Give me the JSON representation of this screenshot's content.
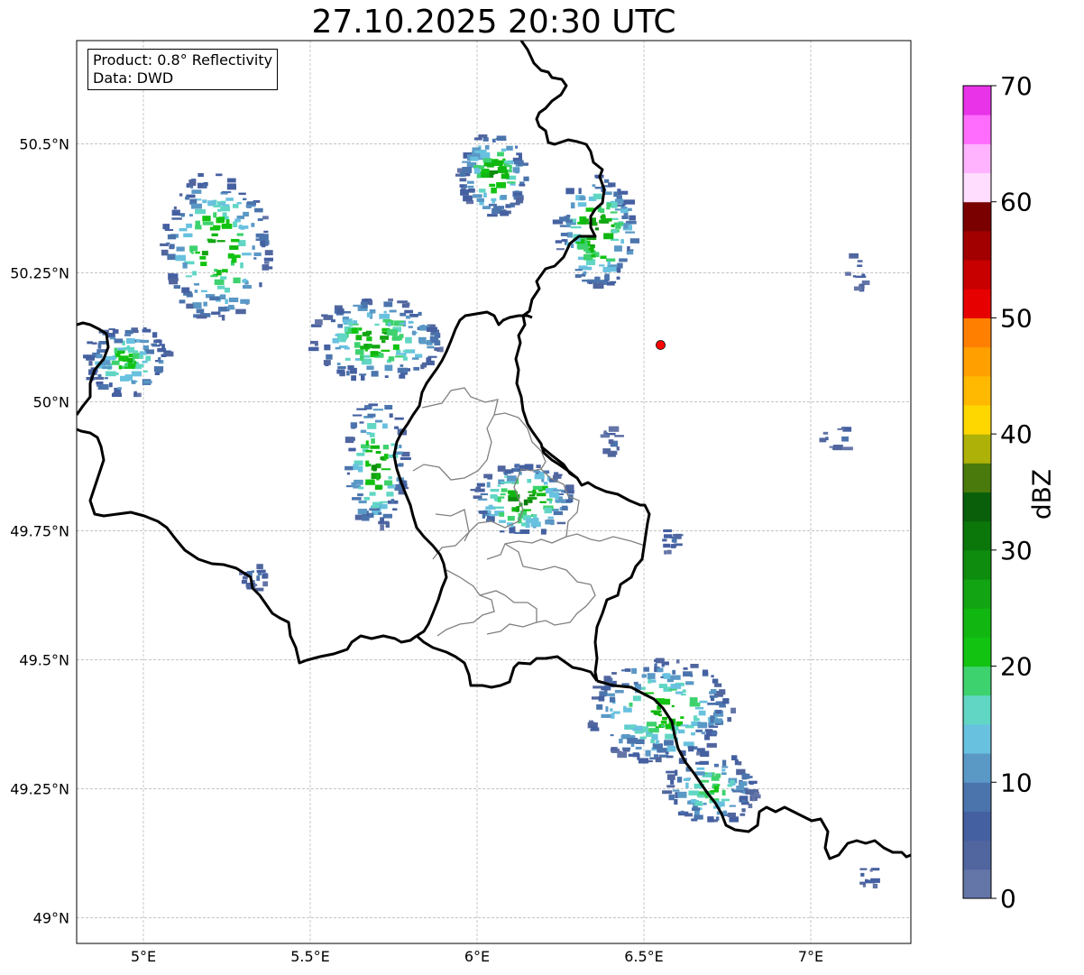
{
  "title": "27.10.2025 20:30 UTC",
  "info": {
    "product": "Product: 0.8° Reflectivity",
    "data": "Data: DWD"
  },
  "map": {
    "lon_range": [
      4.8,
      7.3
    ],
    "lat_range": [
      48.95,
      50.7
    ],
    "lon_ticks": [
      {
        "value": 5.0,
        "label": "5°E"
      },
      {
        "value": 5.5,
        "label": "5.5°E"
      },
      {
        "value": 6.0,
        "label": "6°E"
      },
      {
        "value": 6.5,
        "label": "6.5°E"
      },
      {
        "value": 7.0,
        "label": "7°E"
      }
    ],
    "lat_ticks": [
      {
        "value": 49.0,
        "label": "49°N"
      },
      {
        "value": 49.25,
        "label": "49.25°N"
      },
      {
        "value": 49.5,
        "label": "49.5°N"
      },
      {
        "value": 49.75,
        "label": "49.75°N"
      },
      {
        "value": 50.0,
        "label": "50°N"
      },
      {
        "value": 50.25,
        "label": "50.25°N"
      },
      {
        "value": 50.5,
        "label": "50.5°N"
      }
    ],
    "grid": true,
    "radar_site": {
      "lon": 6.55,
      "lat": 50.11,
      "color": "#ff0000"
    }
  },
  "colorbar": {
    "label": "dBZ",
    "min": 0,
    "max": 70,
    "ticks": [
      {
        "value": 0,
        "label": "0"
      },
      {
        "value": 10,
        "label": "10"
      },
      {
        "value": 20,
        "label": "20"
      },
      {
        "value": 30,
        "label": "30"
      },
      {
        "value": 40,
        "label": "40"
      },
      {
        "value": 50,
        "label": "50"
      },
      {
        "value": 60,
        "label": "60"
      },
      {
        "value": 70,
        "label": "70"
      }
    ],
    "colors": [
      "#6475a8",
      "#51669f",
      "#4560a1",
      "#4b74ad",
      "#5a98c6",
      "#68c1df",
      "#61d6c4",
      "#3ed26e",
      "#12c312",
      "#11b611",
      "#12a412",
      "#0d8c0d",
      "#0b770b",
      "#0a600a",
      "#4a7a0b",
      "#aeb107",
      "#ffd700",
      "#ffb900",
      "#ff9f00",
      "#ff7f00",
      "#e60000",
      "#c80000",
      "#a20000",
      "#7a0000",
      "#ffddff",
      "#ffb3ff",
      "#ff6dff",
      "#e833e8"
    ]
  },
  "echo_clusters": [
    {
      "lon": 5.22,
      "lat": 50.3,
      "rlon": 0.16,
      "rlat": 0.15,
      "peak": 29,
      "cells": 180
    },
    {
      "lon": 4.95,
      "lat": 50.08,
      "rlon": 0.13,
      "rlat": 0.07,
      "peak": 23,
      "cells": 120
    },
    {
      "lon": 5.7,
      "lat": 50.12,
      "rlon": 0.2,
      "rlat": 0.08,
      "peak": 28,
      "cells": 170
    },
    {
      "lon": 6.05,
      "lat": 50.44,
      "rlon": 0.1,
      "rlat": 0.08,
      "peak": 30,
      "cells": 110
    },
    {
      "lon": 6.36,
      "lat": 50.33,
      "rlon": 0.12,
      "rlat": 0.11,
      "peak": 31,
      "cells": 150
    },
    {
      "lon": 5.7,
      "lat": 49.88,
      "rlon": 0.09,
      "rlat": 0.13,
      "peak": 30,
      "cells": 110
    },
    {
      "lon": 6.14,
      "lat": 49.81,
      "rlon": 0.15,
      "rlat": 0.07,
      "peak": 32,
      "cells": 140
    },
    {
      "lon": 6.55,
      "lat": 49.4,
      "rlon": 0.22,
      "rlat": 0.1,
      "peak": 27,
      "cells": 200
    },
    {
      "lon": 6.7,
      "lat": 49.25,
      "rlon": 0.14,
      "rlat": 0.07,
      "peak": 23,
      "cells": 110
    },
    {
      "lon": 5.33,
      "lat": 49.66,
      "rlon": 0.04,
      "rlat": 0.03,
      "peak": 12,
      "cells": 20
    },
    {
      "lon": 7.15,
      "lat": 50.25,
      "rlon": 0.04,
      "rlat": 0.04,
      "peak": 10,
      "cells": 14
    },
    {
      "lon": 7.08,
      "lat": 49.93,
      "rlon": 0.05,
      "rlat": 0.03,
      "peak": 9,
      "cells": 12
    },
    {
      "lon": 6.4,
      "lat": 49.92,
      "rlon": 0.03,
      "rlat": 0.03,
      "peak": 8,
      "cells": 12
    },
    {
      "lon": 6.58,
      "lat": 49.73,
      "rlon": 0.04,
      "rlat": 0.03,
      "peak": 10,
      "cells": 14
    },
    {
      "lon": 7.18,
      "lat": 49.08,
      "rlon": 0.04,
      "rlat": 0.02,
      "peak": 9,
      "cells": 10
    }
  ]
}
